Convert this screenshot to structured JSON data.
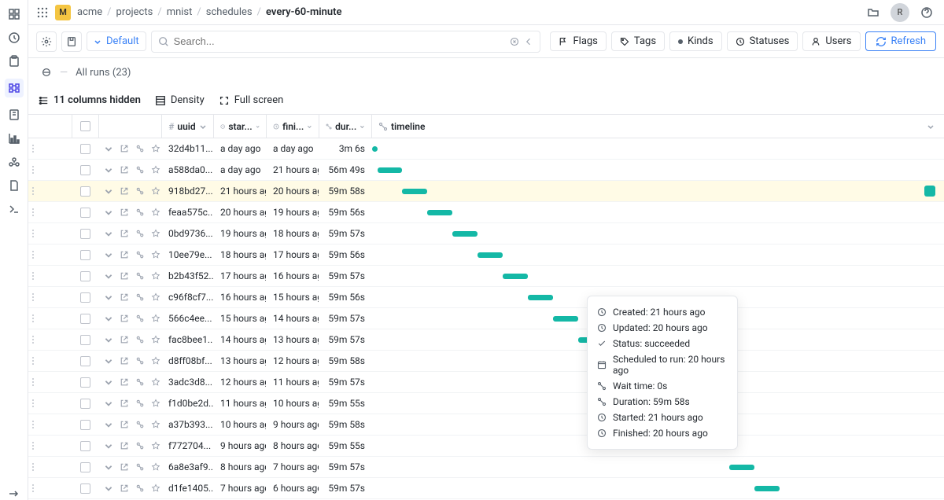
{
  "org_badge": "M",
  "breadcrumbs": [
    "acme",
    "projects",
    "mnist",
    "schedules",
    "every-60-minute"
  ],
  "avatar_initial": "R",
  "default_label": "Default",
  "search_placeholder": "Search...",
  "filters": {
    "flags": "Flags",
    "tags": "Tags",
    "kinds": "Kinds",
    "statuses": "Statuses",
    "users": "Users"
  },
  "refresh_label": "Refresh",
  "all_runs_label": "All runs (23)",
  "columns_hidden_label": "11 columns hidden",
  "density_label": "Density",
  "fullscreen_label": "Full screen",
  "headers": {
    "uuid": "uuid",
    "started": "star...",
    "finished": "fini...",
    "duration": "dur...",
    "timeline": "timeline"
  },
  "rows": [
    {
      "uuid": "32d4b11...",
      "started": "a day ago",
      "finished": "a day ago",
      "duration": "3m 6s",
      "bar_left": 0,
      "bar_width": 0,
      "dot": true
    },
    {
      "uuid": "a588da0...",
      "started": "a day ago",
      "finished": "21 hours ag",
      "duration": "56m 49s",
      "bar_left": 1,
      "bar_width": 4.2
    },
    {
      "uuid": "918bd27...",
      "started": "21 hours ag",
      "finished": "20 hours ag",
      "duration": "59m 58s",
      "bar_left": 5.3,
      "bar_width": 4.4,
      "hl": true,
      "badge": true
    },
    {
      "uuid": "feaa575c...",
      "started": "20 hours ag",
      "finished": "19 hours ag",
      "duration": "59m 56s",
      "bar_left": 9.7,
      "bar_width": 4.4
    },
    {
      "uuid": "0bd9736...",
      "started": "19 hours ag",
      "finished": "18 hours ag",
      "duration": "59m 57s",
      "bar_left": 14.1,
      "bar_width": 4.4
    },
    {
      "uuid": "10ee79e...",
      "started": "18 hours ag",
      "finished": "17 hours ag",
      "duration": "59m 56s",
      "bar_left": 18.5,
      "bar_width": 4.4
    },
    {
      "uuid": "b2b43f52...",
      "started": "17 hours ag",
      "finished": "16 hours ag",
      "duration": "59m 57s",
      "bar_left": 22.9,
      "bar_width": 4.4
    },
    {
      "uuid": "c96f8cf7...",
      "started": "16 hours ag",
      "finished": "15 hours ag",
      "duration": "59m 56s",
      "bar_left": 27.3,
      "bar_width": 4.4
    },
    {
      "uuid": "566c4ee...",
      "started": "15 hours ag",
      "finished": "14 hours ag",
      "duration": "59m 57s",
      "bar_left": 31.7,
      "bar_width": 4.4
    },
    {
      "uuid": "fac8bee1...",
      "started": "14 hours ag",
      "finished": "13 hours ag",
      "duration": "59m 57s",
      "bar_left": 36.1,
      "bar_width": 4.4
    },
    {
      "uuid": "d8ff08bf...",
      "started": "13 hours ag",
      "finished": "12 hours ag",
      "duration": "59m 58s",
      "bar_left": 40.5,
      "bar_width": 4.4
    },
    {
      "uuid": "3adc3d8...",
      "started": "12 hours ag",
      "finished": "11 hours ag",
      "duration": "59m 57s",
      "bar_left": 44.9,
      "bar_width": 4.4
    },
    {
      "uuid": "f1d0be2d...",
      "started": "11 hours ag",
      "finished": "10 hours ag",
      "duration": "59m 55s",
      "bar_left": 49.3,
      "bar_width": 4.4
    },
    {
      "uuid": "a37b393...",
      "started": "10 hours ag",
      "finished": "9 hours ago",
      "duration": "59m 58s",
      "bar_left": 53.7,
      "bar_width": 4.4
    },
    {
      "uuid": "f772704...",
      "started": "9 hours ago",
      "finished": "8 hours ago",
      "duration": "59m 55s",
      "bar_left": 58.1,
      "bar_width": 4.4
    },
    {
      "uuid": "6a8e3af9...",
      "started": "8 hours ago",
      "finished": "7 hours ago",
      "duration": "59m 57s",
      "bar_left": 62.5,
      "bar_width": 4.4
    },
    {
      "uuid": "d1fe1405...",
      "started": "7 hours ago",
      "finished": "6 hours ago",
      "duration": "59m 57s",
      "bar_left": 66.9,
      "bar_width": 4.4
    }
  ],
  "popover": {
    "created": "Created: 21 hours ago",
    "updated": "Updated: 20 hours ago",
    "status": "Status: succeeded",
    "scheduled": "Scheduled to run: 20 hours ago",
    "wait": "Wait time: 0s",
    "duration": "Duration: 59m 58s",
    "started": "Started: 21 hours ago",
    "finished": "Finished: 20 hours ago"
  }
}
